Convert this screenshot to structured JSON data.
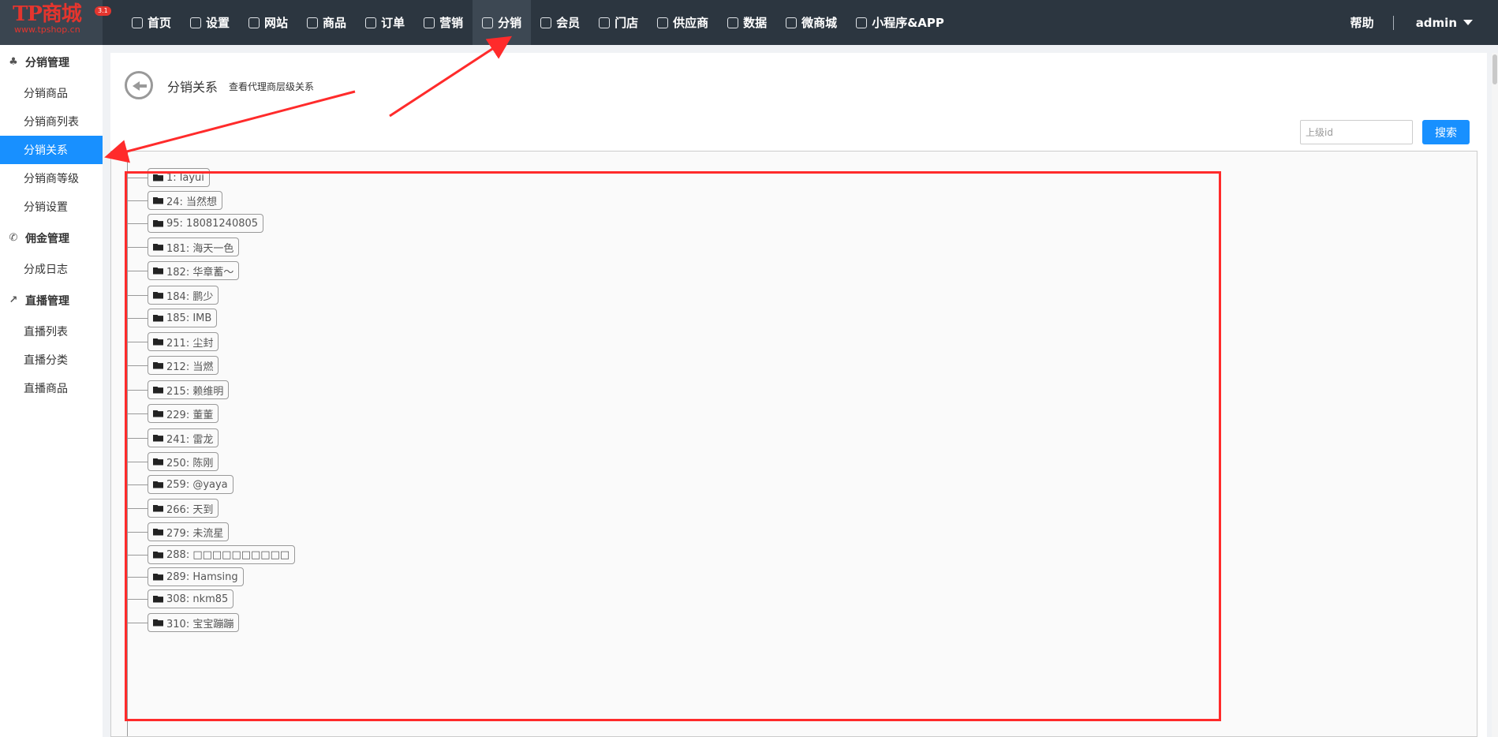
{
  "logo": {
    "text": "TP商城",
    "sub": "www.tpshop.cn",
    "badge": "3.1"
  },
  "nav": [
    {
      "label": "首页",
      "icon": "dashboard-icon"
    },
    {
      "label": "设置",
      "icon": "gear-icon"
    },
    {
      "label": "网站",
      "icon": "website-icon"
    },
    {
      "label": "商品",
      "icon": "bag-icon"
    },
    {
      "label": "订单",
      "icon": "order-icon"
    },
    {
      "label": "营销",
      "icon": "marketing-icon"
    },
    {
      "label": "分销",
      "icon": "distribution-icon"
    },
    {
      "label": "会员",
      "icon": "diamond-icon"
    },
    {
      "label": "门店",
      "icon": "store-icon"
    },
    {
      "label": "供应商",
      "icon": "supplier-icon"
    },
    {
      "label": "数据",
      "icon": "chart-icon"
    },
    {
      "label": "微商城",
      "icon": "wechat-icon"
    },
    {
      "label": "小程序&APP",
      "icon": "cube-icon"
    }
  ],
  "nav_right": {
    "help": "帮助",
    "user": "admin"
  },
  "sidebar": {
    "groups": [
      {
        "title": "分销管理",
        "icon": "org-tree-icon",
        "items": [
          "分销商品",
          "分销商列表",
          "分销关系",
          "分销商等级",
          "分销设置"
        ]
      },
      {
        "title": "佣金管理",
        "icon": "commission-icon",
        "items": [
          "分成日志"
        ]
      },
      {
        "title": "直播管理",
        "icon": "live-chart-icon",
        "items": [
          "直播列表",
          "直播分类",
          "直播商品"
        ]
      }
    ],
    "active_item": "分销关系"
  },
  "page": {
    "title": "分销关系",
    "desc": "查看代理商层级关系"
  },
  "search": {
    "placeholder": "上级id",
    "button": "搜索"
  },
  "tree_nodes": [
    "1: layui",
    "24: 当然想",
    "95: 18081240805",
    "181: 海天一色",
    "182: 华章蓄～",
    "184: 鹏少",
    "185: IMB",
    "211: 尘封",
    "212: 当燃",
    "215: 赖维明",
    "229: 董董",
    "241: 雷龙",
    "250: 陈刚",
    "259: @yaya",
    "266: 天到",
    "279: 未流星",
    "288: □□□□□□□□□□",
    "289: Hamsing",
    "308: nkm85",
    "310: 宝宝蹦蹦"
  ],
  "colors": {
    "topbar": "#2c3640",
    "accent": "#1890ff",
    "annotation": "#ff2b2b",
    "logo": "#e4352e"
  }
}
